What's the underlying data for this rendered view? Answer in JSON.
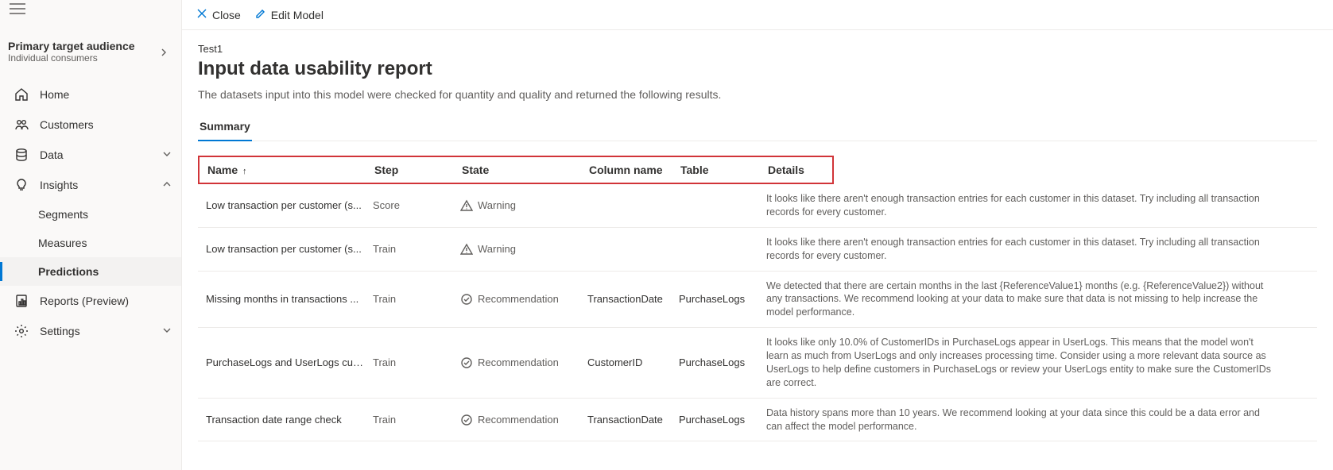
{
  "sidebar": {
    "audience_title": "Primary target audience",
    "audience_sub": "Individual consumers",
    "items": [
      {
        "icon": "home",
        "label": "Home"
      },
      {
        "icon": "customers",
        "label": "Customers"
      },
      {
        "icon": "data",
        "label": "Data",
        "expandable": true,
        "expanded": false
      },
      {
        "icon": "insights",
        "label": "Insights",
        "expandable": true,
        "expanded": true,
        "children": [
          {
            "label": "Segments"
          },
          {
            "label": "Measures"
          },
          {
            "label": "Predictions",
            "active": true
          }
        ]
      },
      {
        "icon": "reports",
        "label": "Reports (Preview)"
      },
      {
        "icon": "settings",
        "label": "Settings",
        "expandable": true,
        "expanded": false
      }
    ]
  },
  "commandbar": {
    "close": "Close",
    "edit_model": "Edit Model"
  },
  "page": {
    "breadcrumb": "Test1",
    "title": "Input data usability report",
    "description": "The datasets input into this model were checked for quantity and quality and returned the following results.",
    "tabs": [
      {
        "label": "Summary",
        "active": true
      }
    ]
  },
  "table": {
    "columns": {
      "name": "Name",
      "step": "Step",
      "state": "State",
      "column_name": "Column name",
      "table": "Table",
      "details": "Details"
    },
    "sort_indicator": "↑",
    "rows": [
      {
        "name": "Low transaction per customer (s...",
        "step": "Score",
        "state": "Warning",
        "state_icon": "warning",
        "column_name": "",
        "table": "",
        "details": "It looks like there aren't enough transaction entries for each customer in this dataset. Try including all transaction records for every customer."
      },
      {
        "name": "Low transaction per customer (s...",
        "step": "Train",
        "state": "Warning",
        "state_icon": "warning",
        "column_name": "",
        "table": "",
        "details": "It looks like there aren't enough transaction entries for each customer in this dataset. Try including all transaction records for every customer."
      },
      {
        "name": "Missing months in transactions ...",
        "step": "Train",
        "state": "Recommendation",
        "state_icon": "recommendation",
        "column_name": "TransactionDate",
        "table": "PurchaseLogs",
        "details": "We detected that there are certain months in the last {ReferenceValue1} months (e.g. {ReferenceValue2}) without any transactions. We recommend looking at your data to make sure that data is not missing to help increase the model performance."
      },
      {
        "name": "PurchaseLogs and UserLogs cus...",
        "step": "Train",
        "state": "Recommendation",
        "state_icon": "recommendation",
        "column_name": "CustomerID",
        "table": "PurchaseLogs",
        "details": "It looks like only 10.0% of CustomerIDs in PurchaseLogs appear in UserLogs. This means that the model won't learn as much from UserLogs and only increases processing time. Consider using a more relevant data source as UserLogs to help define customers in PurchaseLogs or review your UserLogs entity to make sure the CustomerIDs are correct."
      },
      {
        "name": "Transaction date range check",
        "step": "Train",
        "state": "Recommendation",
        "state_icon": "recommendation",
        "column_name": "TransactionDate",
        "table": "PurchaseLogs",
        "details": "Data history spans more than 10 years. We recommend looking at your data since this could be a data error and can affect the model performance."
      }
    ]
  }
}
